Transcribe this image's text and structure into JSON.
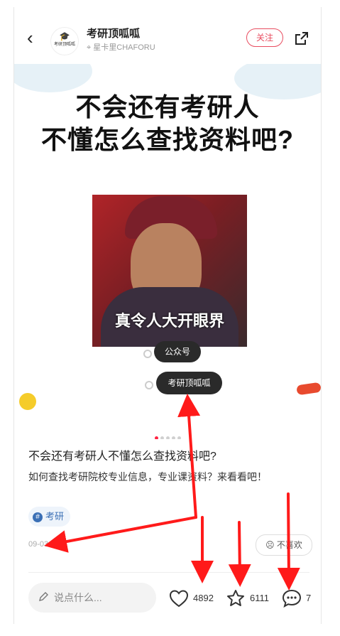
{
  "header": {
    "author_name": "考研顶呱呱",
    "location": "星卡里CHAFORU",
    "follow_label": "关注",
    "logo_text": "考研顶呱呱"
  },
  "image": {
    "headline_line1": "不会还有考研人",
    "headline_line2": "不懂怎么查找资料吧?",
    "meme_caption": "真令人大开眼界",
    "tag1": "公众号",
    "tag2": "考研顶呱呱",
    "pager_total": 5,
    "pager_active": 1
  },
  "post": {
    "title": "不会还有考研人不懂怎么查找资料吧?",
    "body": "如何查找考研院校专业信息，专业课资料？来看看吧！",
    "topic": "考研",
    "date": "09-03",
    "dislike_label": "不喜欢"
  },
  "bottom_bar": {
    "comment_placeholder": "说点什么...",
    "like_count": "4892",
    "collect_count": "6111",
    "comment_count": "7"
  },
  "colors": {
    "accent": "#ff2442",
    "follow": "#e84d60",
    "annotation": "#ff1a1a"
  }
}
